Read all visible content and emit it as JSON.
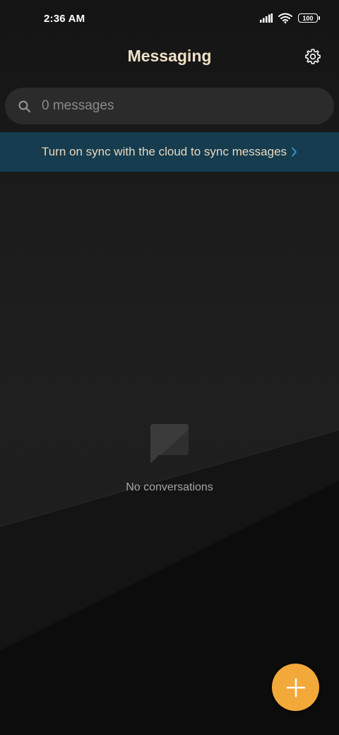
{
  "status_bar": {
    "time": "2:36 AM",
    "battery_level": "100",
    "icons": [
      "signal-icon",
      "wifi-icon",
      "battery-icon"
    ]
  },
  "header": {
    "title": "Messaging",
    "settings_icon": "gear-icon"
  },
  "search": {
    "placeholder": "0 messages",
    "value": "",
    "icon": "search-icon"
  },
  "sync_banner": {
    "text": "Turn on sync with the cloud to sync messages",
    "chevron_icon": "chevron-right-icon"
  },
  "empty_state": {
    "icon": "message-bubble-icon",
    "text": "No conversations"
  },
  "fab": {
    "icon": "plus-icon"
  },
  "colors": {
    "title": "#efe0c8",
    "banner_bg": "#153c4f",
    "chevron": "#3a9ad6",
    "fab": "#f3a93a"
  }
}
